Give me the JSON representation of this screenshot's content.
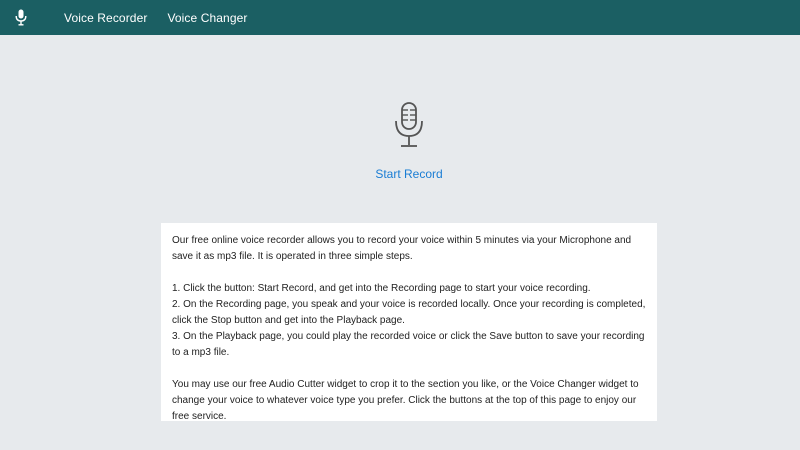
{
  "nav": {
    "items": [
      {
        "label": "Voice Recorder"
      },
      {
        "label": "Voice Changer"
      }
    ],
    "logo_icon": "microphone-icon"
  },
  "recorder": {
    "icon": "microphone-icon",
    "start_label": "Start Record"
  },
  "info": {
    "intro": "Our free online voice recorder allows you to record your voice within 5 minutes via your Microphone and save it as mp3 file. It is operated in three simple steps.",
    "step1": "1. Click the button: Start Record, and get into the Recording page to start your voice recording.",
    "step2": "2. On the Recording page, you speak and your voice is recorded locally. Once your recording is completed, click the Stop button and get into the Playback page.",
    "step3": "3. On the Playback page, you could play the recorded voice or click the Save button to save your recording to a mp3 file.",
    "outro": "You may use our free Audio Cutter widget to crop it to the section you like, or the Voice Changer widget to change your voice to whatever voice type you prefer. Click the buttons at the top of this page to enjoy our free service."
  },
  "colors": {
    "navbar": "#1b5f63",
    "background": "#e7eaed",
    "link": "#1a7dd4"
  }
}
